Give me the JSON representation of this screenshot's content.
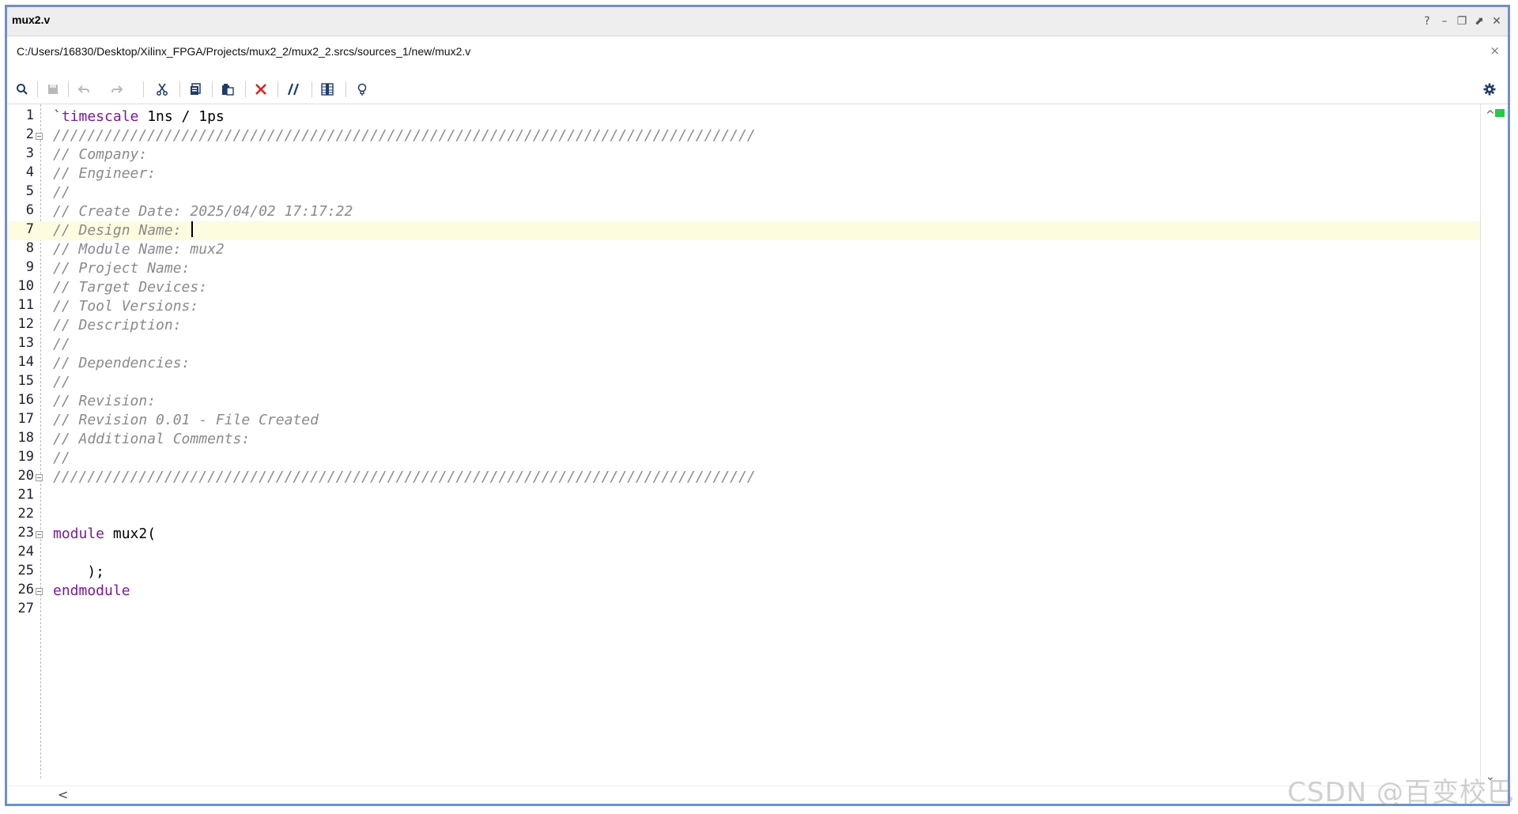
{
  "window": {
    "title": "mux2.v",
    "controls": [
      {
        "name": "help",
        "symbol": "?"
      },
      {
        "name": "minimize",
        "symbol": "–"
      },
      {
        "name": "restore",
        "symbol": "❐"
      },
      {
        "name": "float",
        "symbol": "⬈"
      },
      {
        "name": "close",
        "symbol": "✕"
      }
    ]
  },
  "file_path": "C:/Users/16830/Desktop/Xilinx_FPGA/Projects/mux2_2/mux2_2.srcs/sources_1/new/mux2.v",
  "path_close_symbol": "×",
  "toolbar": {
    "buttons": [
      "search-icon",
      "save-icon",
      "undo-icon",
      "redo-icon",
      "cut-icon",
      "copy-icon",
      "paste-icon",
      "delete-icon",
      "comment-toggle-icon",
      "column-select-icon",
      "lightbulb-icon"
    ],
    "settings": "gear-icon"
  },
  "editor": {
    "current_line": 7,
    "lines": [
      {
        "n": "1",
        "text": "`timescale 1ns / 1ps",
        "style": "timescale"
      },
      {
        "n": "2",
        "text": "//////////////////////////////////////////////////////////////////////////////////",
        "style": "cm",
        "fold": true
      },
      {
        "n": "3",
        "text": "// Company:",
        "style": "cm"
      },
      {
        "n": "4",
        "text": "// Engineer:",
        "style": "cm"
      },
      {
        "n": "5",
        "text": "//",
        "style": "cm"
      },
      {
        "n": "6",
        "text": "// Create Date: 2025/04/02 17:17:22",
        "style": "cm"
      },
      {
        "n": "7",
        "text": "// Design Name: ",
        "style": "cm"
      },
      {
        "n": "8",
        "text": "// Module Name: mux2",
        "style": "cm"
      },
      {
        "n": "9",
        "text": "// Project Name:",
        "style": "cm"
      },
      {
        "n": "10",
        "text": "// Target Devices:",
        "style": "cm"
      },
      {
        "n": "11",
        "text": "// Tool Versions:",
        "style": "cm"
      },
      {
        "n": "12",
        "text": "// Description:",
        "style": "cm"
      },
      {
        "n": "13",
        "text": "//",
        "style": "cm"
      },
      {
        "n": "14",
        "text": "// Dependencies:",
        "style": "cm"
      },
      {
        "n": "15",
        "text": "//",
        "style": "cm"
      },
      {
        "n": "16",
        "text": "// Revision:",
        "style": "cm"
      },
      {
        "n": "17",
        "text": "// Revision 0.01 - File Created",
        "style": "cm"
      },
      {
        "n": "18",
        "text": "// Additional Comments:",
        "style": "cm"
      },
      {
        "n": "19",
        "text": "//",
        "style": "cm"
      },
      {
        "n": "20",
        "text": "//////////////////////////////////////////////////////////////////////////////////",
        "style": "cm",
        "fold": true
      },
      {
        "n": "21",
        "text": "",
        "style": "plain"
      },
      {
        "n": "22",
        "text": "",
        "style": "plain"
      },
      {
        "n": "23",
        "text": "module mux2(",
        "style": "module",
        "fold": true
      },
      {
        "n": "24",
        "text": "",
        "style": "plain"
      },
      {
        "n": "25",
        "text": "    );",
        "style": "plain"
      },
      {
        "n": "26",
        "text": "endmodule",
        "style": "kw",
        "fold": true
      },
      {
        "n": "27",
        "text": "",
        "style": "plain"
      }
    ]
  },
  "watermark": "CSDN @百变校巴",
  "colors": {
    "frame": "#6f8fd0",
    "keyword": "#7a1a9a",
    "comment": "#8a8a8a",
    "current_line": "#fdfbe0",
    "marker": "#22cc44",
    "delete_red": "#e02020"
  }
}
